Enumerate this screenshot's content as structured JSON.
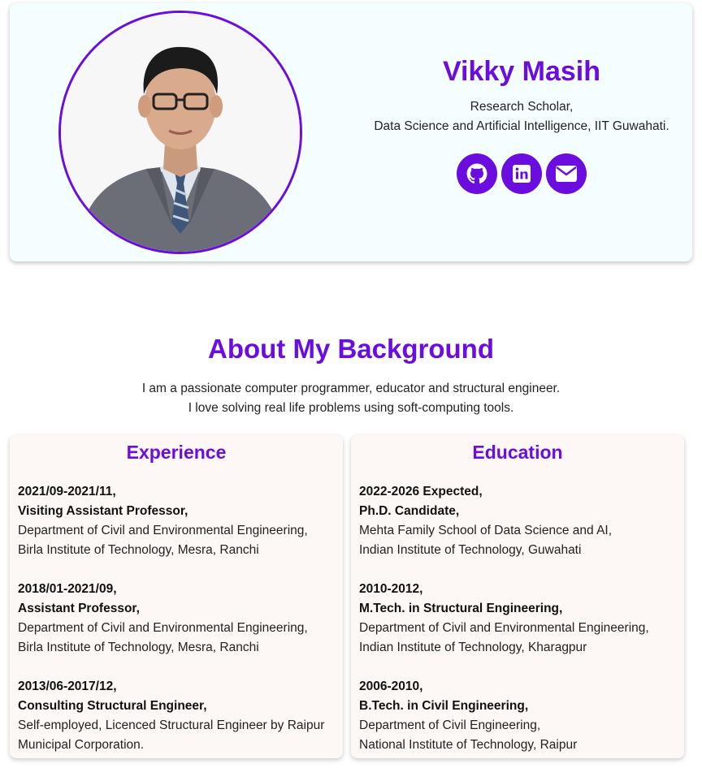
{
  "profile": {
    "name": "Vikky Masih",
    "role_line1": "Research Scholar,",
    "role_line2": "Data Science and Artificial Intelligence, IIT Guwahati."
  },
  "socials": [
    {
      "name": "github",
      "icon": "github-icon"
    },
    {
      "name": "linkedin",
      "icon": "linkedin-icon"
    },
    {
      "name": "email",
      "icon": "envelope-icon"
    }
  ],
  "about": {
    "title": "About My Background",
    "line1": "I am a passionate computer programmer, educator and structural engineer.",
    "line2": "I love solving real life problems using soft-computing tools."
  },
  "experience": {
    "title": "Experience",
    "items": [
      {
        "date": "2021/09-2021/11,",
        "position": "Visiting Assistant Professor,",
        "line1": "Department of Civil and Environmental Engineering,",
        "line2": "Birla Institute of Technology, Mesra, Ranchi"
      },
      {
        "date": "2018/01-2021/09,",
        "position": "Assistant Professor,",
        "line1": "Department of Civil and Environmental Engineering,",
        "line2": "Birla Institute of Technology, Mesra, Ranchi"
      },
      {
        "date": "2013/06-2017/12,",
        "position": "Consulting Structural Engineer,",
        "line1": "Self-employed, Licenced Structural Engineer by Raipur",
        "line2": "Municipal Corporation."
      }
    ]
  },
  "education": {
    "title": "Education",
    "items": [
      {
        "date": "2022-2026 Expected,",
        "degree": "Ph.D. Candidate,",
        "line1": "Mehta Family School of Data Science and AI,",
        "line2": "Indian Institute of Technology, Guwahati"
      },
      {
        "date": "2010-2012,",
        "degree": "M.Tech. in Structural Engineering,",
        "line1": "Department of Civil and Environmental Engineering,",
        "line2": "Indian Institute of Technology, Kharagpur"
      },
      {
        "date": "2006-2010,",
        "degree": "B.Tech. in Civil Engineering,",
        "line1": "Department of Civil Engineering,",
        "line2": "National Institute of Technology, Raipur"
      }
    ]
  },
  "colors": {
    "accent": "#6a0dde",
    "hero_bg": "#f5feff",
    "card_bg": "#fdf8f6"
  }
}
